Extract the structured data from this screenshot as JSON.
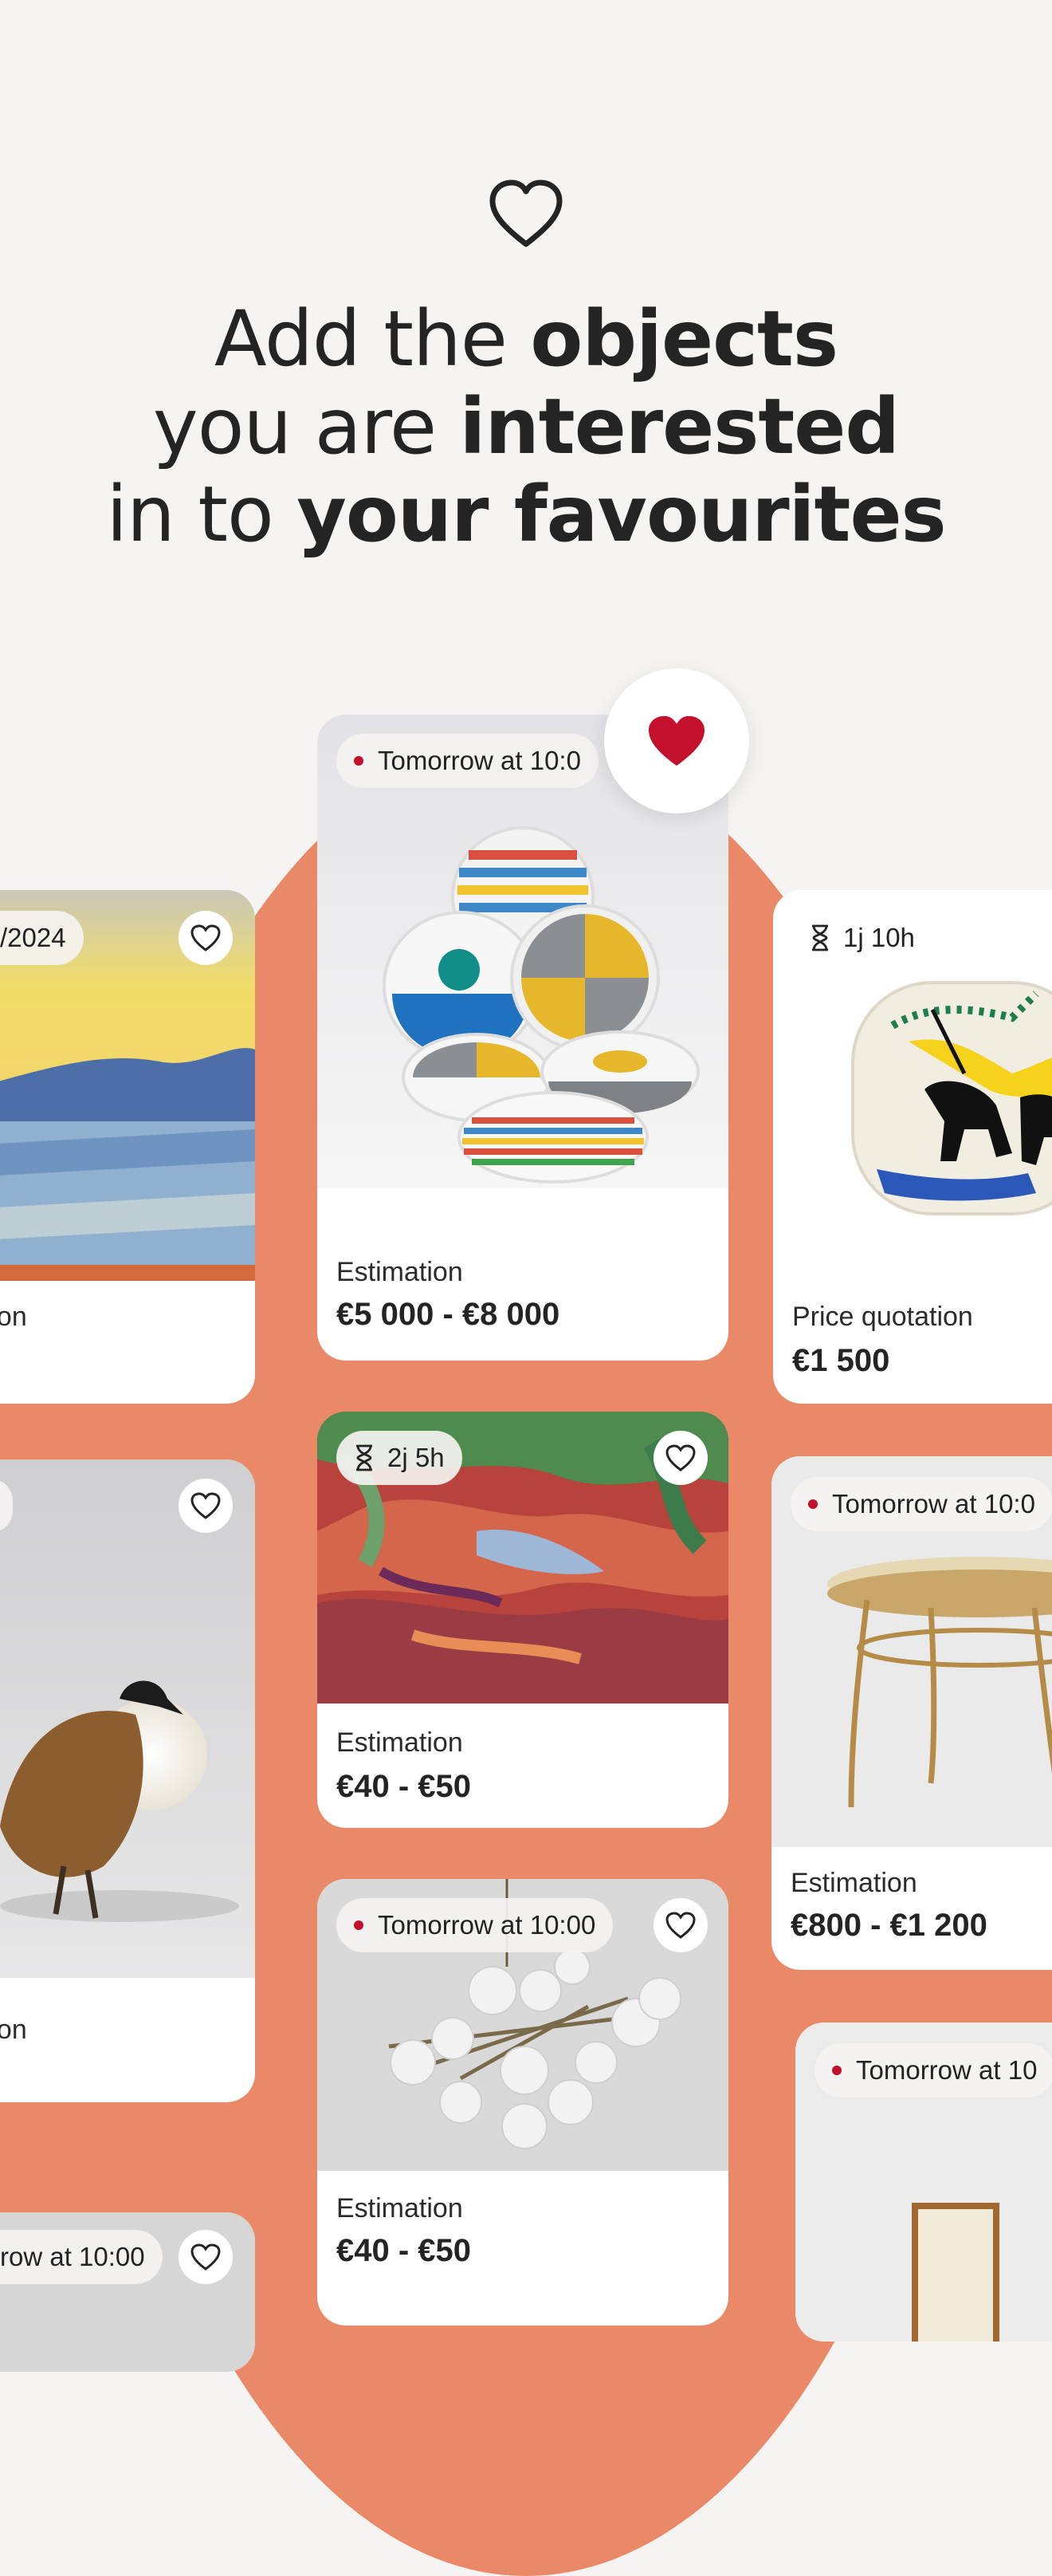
{
  "headline": {
    "l1_a": "Add the ",
    "l1_b": "objects",
    "l2_a": "you are ",
    "l2_b": "interested",
    "l3_a": "in to ",
    "l3_b": "your favourites"
  },
  "colors": {
    "background": "#f5f4f2",
    "accent": "#e98967",
    "brand_red": "#c3102c"
  },
  "icons": {
    "hero": "heart-outline-icon",
    "active_favourite": "heart-filled-icon",
    "timer": "hourglass-icon",
    "live": "red-dot-icon"
  },
  "cards": {
    "left_top": {
      "badge": "/2024",
      "label": "ation"
    },
    "center_top": {
      "badge": "Tomorrow at 10:0",
      "label": "Estimation",
      "price": "€5 000 - €8 000"
    },
    "right_top": {
      "badge": "1j 10h",
      "label": "Price quotation",
      "price": "€1 500"
    },
    "left_mid": {
      "label": "ation"
    },
    "center_mid": {
      "badge": "2j 5h",
      "label": "Estimation",
      "price": "€40 - €50"
    },
    "right_mid": {
      "badge": "Tomorrow at 10:0",
      "label": "Estimation",
      "price": "€800 - €1 200"
    },
    "center_low": {
      "badge": "Tomorrow at 10:00",
      "label": "Estimation",
      "price": "€40 - €50"
    },
    "right_low": {
      "badge": "Tomorrow at 10"
    },
    "left_low": {
      "badge": "row at 10:00"
    }
  }
}
